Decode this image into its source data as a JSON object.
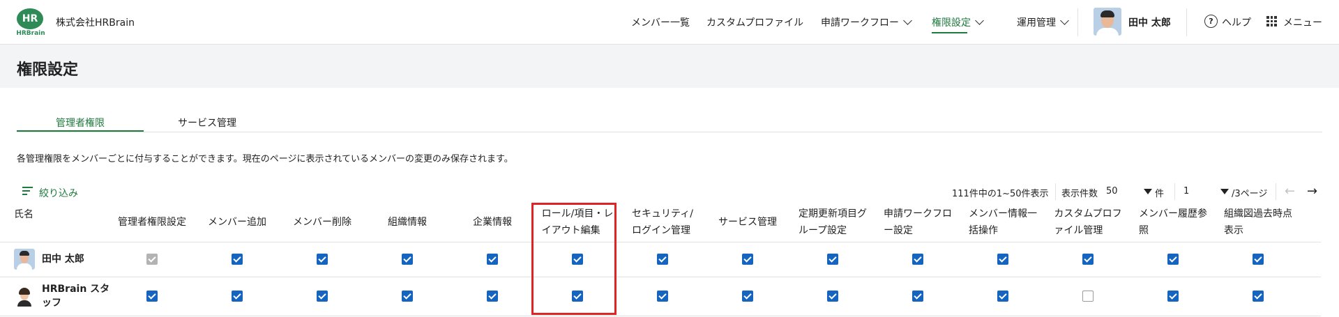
{
  "header": {
    "logo": {
      "mark": "HR",
      "sub": "HRBrain"
    },
    "company": "株式会社HRBrain",
    "nav": [
      {
        "label": "メンバー一覧",
        "dropdown": false,
        "active": false
      },
      {
        "label": "カスタムプロファイル",
        "dropdown": false,
        "active": false
      },
      {
        "label": "申請ワークフロー",
        "dropdown": true,
        "active": false
      },
      {
        "label": "権限設定",
        "dropdown": true,
        "active": true
      },
      {
        "label": "運用管理",
        "dropdown": true,
        "active": false
      }
    ],
    "user_name": "田中 太郎",
    "help_icon_glyph": "?",
    "help_label": "ヘルプ",
    "menu_label": "メニュー"
  },
  "page_title": "権限設定",
  "tabs": [
    {
      "label": "管理者権限",
      "active": true
    },
    {
      "label": "サービス管理",
      "active": false
    }
  ],
  "description": "各管理権限をメンバーごとに付与することができます。現在のページに表示されているメンバーの変更のみ保存されます。",
  "filter_label": "絞り込み",
  "pagination": {
    "summary": "111件中の1~50件表示",
    "per_page_label": "表示件数",
    "per_page_value": "50",
    "per_page_unit": "件",
    "page_value": "1",
    "page_total": "/3ページ",
    "prev_glyph": "←",
    "next_glyph": "→"
  },
  "table": {
    "name_header": "氏名",
    "columns": [
      [
        "管理者権限設定"
      ],
      [
        "メンバー追加"
      ],
      [
        "メンバー削除"
      ],
      [
        "組織情報"
      ],
      [
        "企業情報"
      ],
      [
        "ロール/項目・レ",
        "イアウト編集"
      ],
      [
        "セキュリティ/",
        "ログイン管理"
      ],
      [
        "サービス管理"
      ],
      [
        "定期更新項目グ",
        "ループ設定"
      ],
      [
        "申請ワークフロ",
        "ー設定"
      ],
      [
        "メンバー情報一",
        "括操作"
      ],
      [
        "カスタムプロフ",
        "ァイル管理"
      ],
      [
        "メンバー履歴参",
        "照"
      ],
      [
        "組織図過去時点",
        "表示"
      ]
    ],
    "rows": [
      {
        "name": [
          "田中 太郎"
        ],
        "checks": [
          "disabled",
          "on",
          "on",
          "on",
          "on",
          "on",
          "on",
          "on",
          "on",
          "on",
          "on",
          "on",
          "on",
          "on"
        ]
      },
      {
        "name": [
          "HRBrain スタ",
          "ッフ"
        ],
        "checks": [
          "on",
          "on",
          "on",
          "on",
          "on",
          "on",
          "on",
          "on",
          "on",
          "on",
          "on",
          "off",
          "on",
          "on"
        ]
      }
    ]
  },
  "colors": {
    "brand_green": "#1f7a3d",
    "checkbox_blue": "#1565c0",
    "highlight_red": "#e02424"
  }
}
